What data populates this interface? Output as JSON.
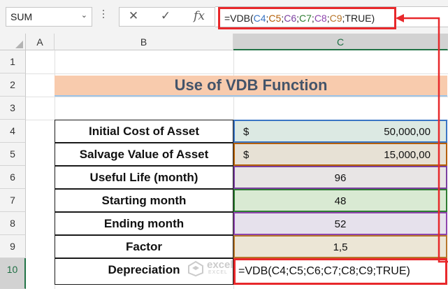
{
  "formula_bar": {
    "name_box": "SUM",
    "cancel_icon": "✕",
    "enter_icon": "✓",
    "fx_label": "fx",
    "formula": {
      "prefix": "=VDB(",
      "refs": [
        "C4",
        "C5",
        "C6",
        "C7",
        "C8",
        "C9"
      ],
      "separator": ";",
      "suffix": ";TRUE)"
    }
  },
  "columns": [
    "A",
    "B",
    "C"
  ],
  "rows": [
    "1",
    "2",
    "3",
    "4",
    "5",
    "6",
    "7",
    "8",
    "9",
    "10"
  ],
  "title": "Use of VDB Function",
  "table": {
    "labels": [
      "Initial Cost of Asset",
      "Salvage Value of Asset",
      "Useful Life (month)",
      "Starting month",
      "Ending month",
      "Factor",
      "Depreciation"
    ],
    "initial_cost": {
      "currency": "$",
      "amount": "50,000,00"
    },
    "salvage_value": {
      "currency": "$",
      "amount": "15,000,00"
    },
    "useful_life": "96",
    "start_month": "48",
    "end_month": "52",
    "factor": "1,5",
    "depreciation_formula": "=VDB(C4;C5;C6;C7;C8;C9;TRUE)"
  },
  "watermark": {
    "name": "exceldemy",
    "tagline": "EXCEL · DATA · BI"
  },
  "colors": {
    "title_fill": "#f8cbad",
    "title_text": "#44546a",
    "highlight_red": "#e8282b",
    "active_header": "#217346"
  }
}
